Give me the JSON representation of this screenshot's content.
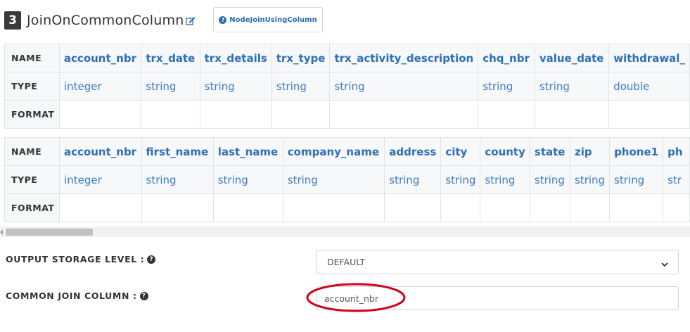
{
  "header": {
    "step_number": "3",
    "title": "JoinOnCommonColumn",
    "node_button_label": "NodeJoinUsingColumn"
  },
  "row_labels": {
    "name": "NAME",
    "type": "TYPE",
    "format": "FORMAT"
  },
  "table1": {
    "columns": [
      {
        "name": "account_nbr",
        "type": "integer"
      },
      {
        "name": "trx_date",
        "type": "string"
      },
      {
        "name": "trx_details",
        "type": "string"
      },
      {
        "name": "trx_type",
        "type": "string"
      },
      {
        "name": "trx_activity_description",
        "type": "string"
      },
      {
        "name": "chq_nbr",
        "type": "string"
      },
      {
        "name": "value_date",
        "type": "string"
      },
      {
        "name": "withdrawal_",
        "type": "double"
      }
    ]
  },
  "table2": {
    "columns": [
      {
        "name": "account_nbr",
        "type": "integer"
      },
      {
        "name": "first_name",
        "type": "string"
      },
      {
        "name": "last_name",
        "type": "string"
      },
      {
        "name": "company_name",
        "type": "string"
      },
      {
        "name": "address",
        "type": "string"
      },
      {
        "name": "city",
        "type": "string"
      },
      {
        "name": "county",
        "type": "string"
      },
      {
        "name": "state",
        "type": "string"
      },
      {
        "name": "zip",
        "type": "string"
      },
      {
        "name": "phone1",
        "type": "string"
      },
      {
        "name": "ph",
        "type": "str"
      }
    ]
  },
  "form": {
    "storage_label": "OUTPUT STORAGE LEVEL :",
    "storage_value": "DEFAULT",
    "join_label": "COMMON JOIN COLUMN :",
    "join_value": "account_nbr"
  },
  "colors": {
    "accent": "#2d6fb6",
    "highlight": "#d0021b"
  }
}
